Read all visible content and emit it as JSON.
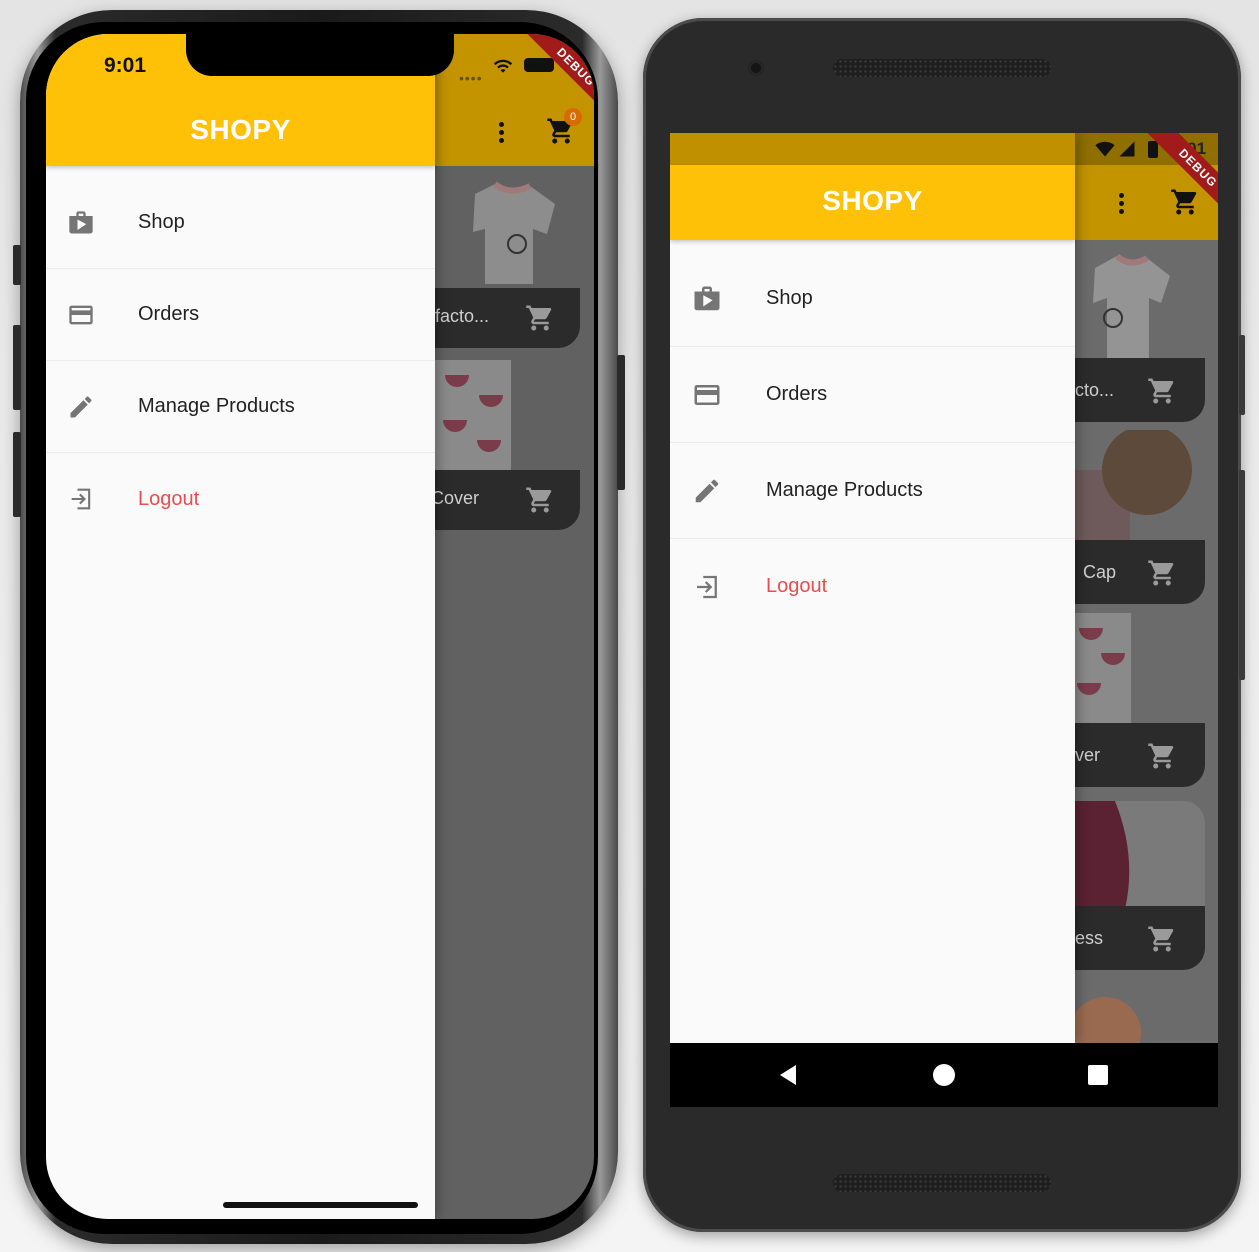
{
  "app": {
    "title": "SHOPY",
    "status_time": "9:01",
    "cart_badge": "0",
    "debug_label": "DEBUG"
  },
  "drawer": {
    "items": [
      {
        "label": "Shop",
        "icon": "shop-icon"
      },
      {
        "label": "Orders",
        "icon": "credit-card-icon"
      },
      {
        "label": "Manage Products",
        "icon": "edit-pencil-icon"
      },
      {
        "label": "Logout",
        "icon": "logout-icon"
      }
    ]
  },
  "products_ios": [
    {
      "title_fragment": "facto..."
    },
    {
      "title_fragment": "Cover"
    }
  ],
  "products_android": [
    {
      "title_fragment": "cto..."
    },
    {
      "title_fragment": "Cap"
    },
    {
      "title_fragment": "ver"
    },
    {
      "title_fragment": "ess"
    }
  ],
  "colors": {
    "accent": "#ffc107",
    "logout": "#e94d4d",
    "drawer_bg": "#fafafa"
  }
}
